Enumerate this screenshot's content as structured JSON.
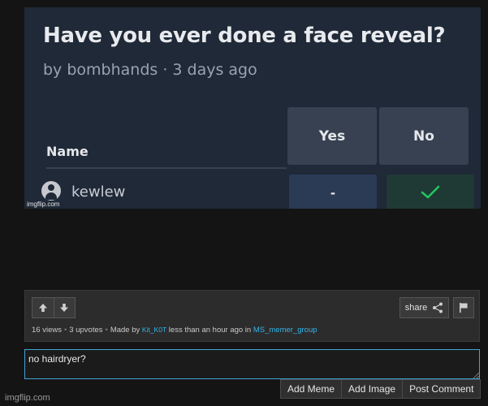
{
  "meme": {
    "title": "Have you ever done a face reveal?",
    "byline": "by bombhands · 3 days ago",
    "name_header": "Name",
    "yes_header": "Yes",
    "no_header": "No",
    "voter_name": "kewlew",
    "yes_value": "-",
    "no_check_icon": "check-icon",
    "watermark": "imgflip.com"
  },
  "stats": {
    "views": "16 views",
    "upvotes": "3 upvotes",
    "made_by_prefix": "Made by",
    "author": "Kit_K0T",
    "time_text": "less than an hour ago in",
    "stream": "MS_memer_group"
  },
  "toolbar": {
    "share_label": "share"
  },
  "comment": {
    "value": "no hairdryer?"
  },
  "actions": {
    "add_meme": "Add Meme",
    "add_image": "Add Image",
    "post_comment": "Post Comment"
  },
  "footer": {
    "watermark": "imgflip.com"
  },
  "colors": {
    "link": "#34b5ea",
    "focus_border": "#3fa4d6",
    "check": "#22c55e"
  }
}
